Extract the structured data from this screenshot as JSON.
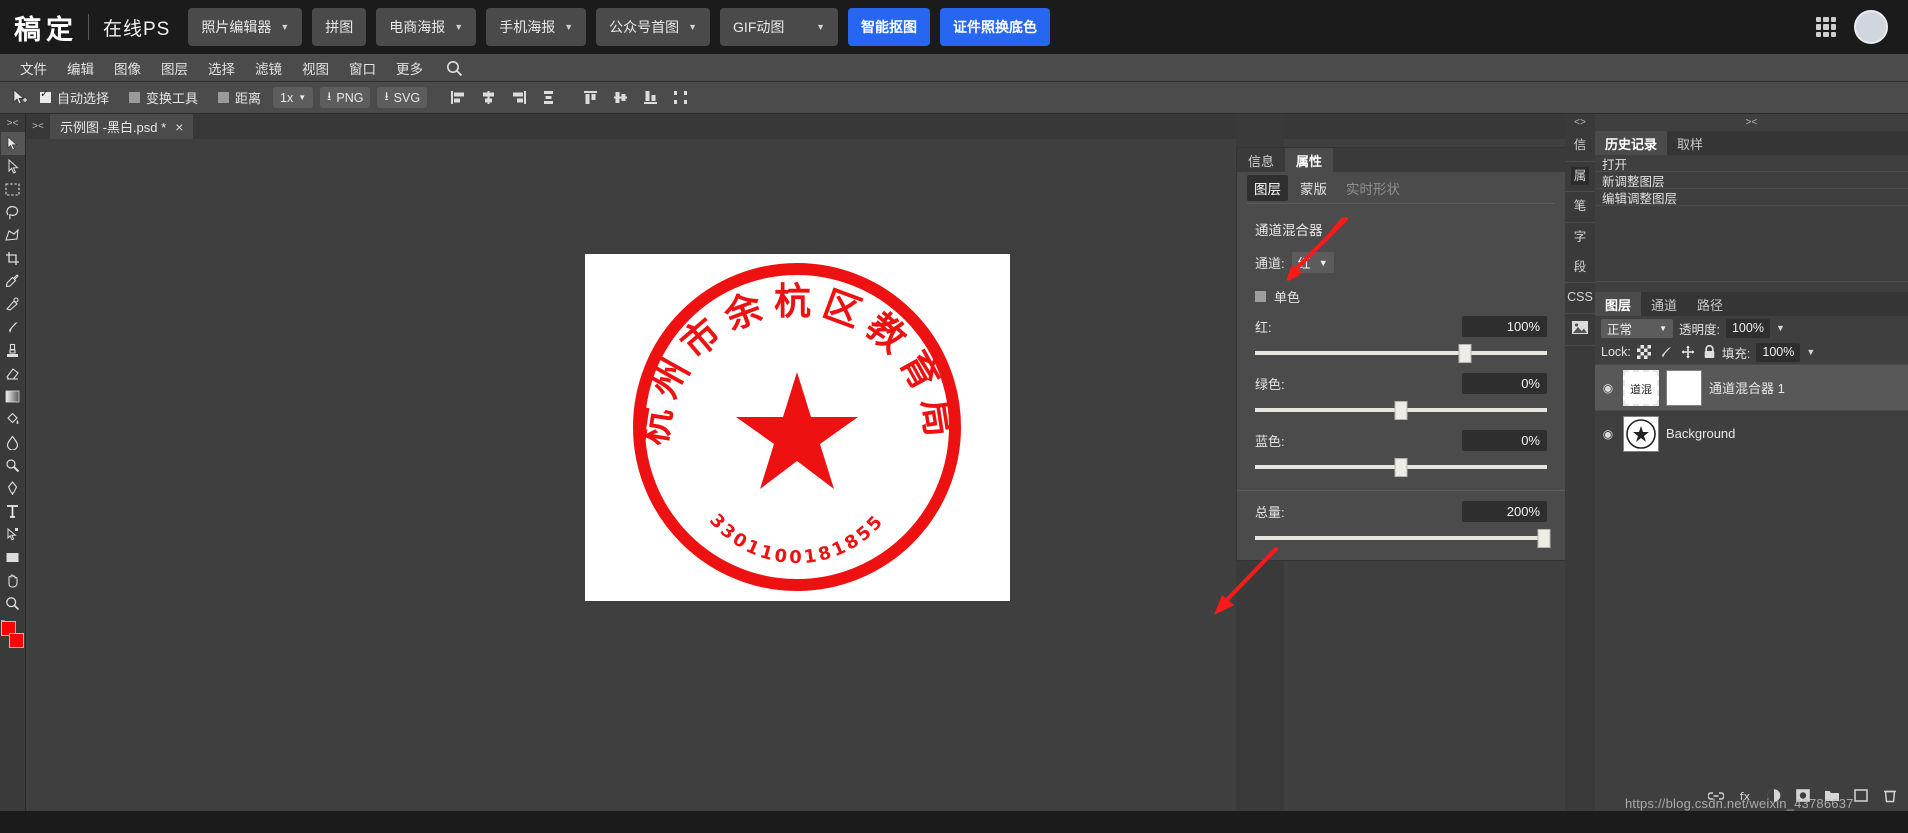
{
  "brand": {
    "logo": "稿定",
    "sub": "在线PS"
  },
  "topbar_buttons": [
    {
      "label": "照片编辑器",
      "caret": true,
      "accent": false
    },
    {
      "label": "拼图",
      "caret": false,
      "accent": false
    },
    {
      "label": "电商海报",
      "caret": true,
      "accent": false
    },
    {
      "label": "手机海报",
      "caret": true,
      "accent": false
    },
    {
      "label": "公众号首图",
      "caret": true,
      "accent": false
    },
    {
      "label": "GIF动图",
      "caret": true,
      "accent": false,
      "wide": true
    },
    {
      "label": "智能抠图",
      "caret": false,
      "accent": true
    },
    {
      "label": "证件照换底色",
      "caret": false,
      "accent": true
    }
  ],
  "topbar_icons": {
    "apps": "grid-apps-icon",
    "avatar": "user-avatar"
  },
  "menubar": [
    "文件",
    "编辑",
    "图像",
    "图层",
    "选择",
    "滤镜",
    "视图",
    "窗口",
    "更多"
  ],
  "menubar_search": "search-icon",
  "options": {
    "move_tool_icon": "move-tool-icon",
    "checkboxes": [
      {
        "label": "自动选择",
        "checked": true
      },
      {
        "label": "变换工具",
        "checked": false
      },
      {
        "label": "距离",
        "checked": false
      }
    ],
    "zoom": "1x",
    "export_png": "PNG",
    "export_svg": "SVG"
  },
  "document": {
    "tab_title": "示例图 -黑白.psd *",
    "close": "×"
  },
  "left_tools": [
    "move-tool",
    "direct-select-tool",
    "marquee-tool",
    "lasso-tool",
    "polygon-lasso-tool",
    "crop-tool",
    "eyedropper-tool",
    "healing-brush-tool",
    "brush-tool",
    "stamp-tool",
    "eraser-tool",
    "gradient-tool",
    "paint-bucket-tool",
    "blur-tool",
    "dodge-tool",
    "pen-tool",
    "type-tool",
    "path-select-tool",
    "shape-tool",
    "hand-tool",
    "zoom-tool"
  ],
  "swatches": {
    "foreground": "#ff0000",
    "background": "#ff0000",
    "label": "D"
  },
  "properties": {
    "tabs": [
      {
        "label": "信息",
        "selected": false
      },
      {
        "label": "属性",
        "selected": true
      }
    ],
    "subtabs": [
      {
        "label": "图层",
        "selected": true,
        "dim": false
      },
      {
        "label": "蒙版",
        "selected": false,
        "dim": false
      },
      {
        "label": "实时形状",
        "selected": false,
        "dim": true
      }
    ],
    "title": "通道混合器",
    "channel_label": "通道:",
    "channel_value": "红",
    "monochrome_label": "单色",
    "monochrome_checked": false,
    "sliders": [
      {
        "name": "红:",
        "value": "100%",
        "pos": 72
      },
      {
        "name": "绿色:",
        "value": "0%",
        "pos": 50
      },
      {
        "name": "蓝色:",
        "value": "0%",
        "pos": 50
      },
      {
        "name": "总量:",
        "value": "200%",
        "pos": 99
      }
    ]
  },
  "vertical_tabs": [
    {
      "label": "信",
      "selected": false
    },
    {
      "label": "属",
      "selected": true
    },
    {
      "label": "笔",
      "selected": false
    },
    {
      "label": "字",
      "selected": false
    },
    {
      "label": "段",
      "selected": false
    },
    {
      "label": "CSS",
      "selected": false
    },
    {
      "label": "image-icon",
      "selected": false,
      "is_icon": true
    }
  ],
  "history": {
    "tabs": [
      {
        "label": "历史记录",
        "selected": true
      },
      {
        "label": "取样",
        "selected": false
      }
    ],
    "items": [
      "打开",
      "新调整图层",
      "编辑调整图层"
    ]
  },
  "layers": {
    "tabs": [
      {
        "label": "图层",
        "selected": true
      },
      {
        "label": "通道",
        "selected": false
      },
      {
        "label": "路径",
        "selected": false
      }
    ],
    "blend_mode": "正常",
    "opacity_label": "透明度:",
    "opacity_value": "100%",
    "lock_label": "Lock:",
    "lock_icons": [
      "transparency-lock-icon",
      "brush-lock-icon",
      "move-lock-icon",
      "all-lock-icon"
    ],
    "fill_label": "填充:",
    "fill_value": "100%",
    "items": [
      {
        "name": "通道混合器 1",
        "visible": true,
        "selected": true,
        "thumb": "adjustment-thumb"
      },
      {
        "name": "Background",
        "visible": true,
        "selected": false,
        "thumb": "stamp-thumb"
      }
    ],
    "footer_icons": [
      "link-layers-icon",
      "layer-effects-icon",
      "adjustment-layer-icon",
      "layer-mask-icon",
      "new-group-icon",
      "new-layer-icon",
      "delete-layer-icon"
    ]
  },
  "canvas": {
    "stamp_text_top": "杭州市余杭区教育局",
    "stamp_number": "3301100181855",
    "stamp_color": "#ee1111"
  },
  "watermark": "https://blog.csdn.net/weixin_43786637",
  "accent_colors": {
    "primary": "#2766f0",
    "arrow": "#fb1a1a",
    "panel_bg": "#4b4b4b",
    "app_bg": "#3f3f3f"
  }
}
